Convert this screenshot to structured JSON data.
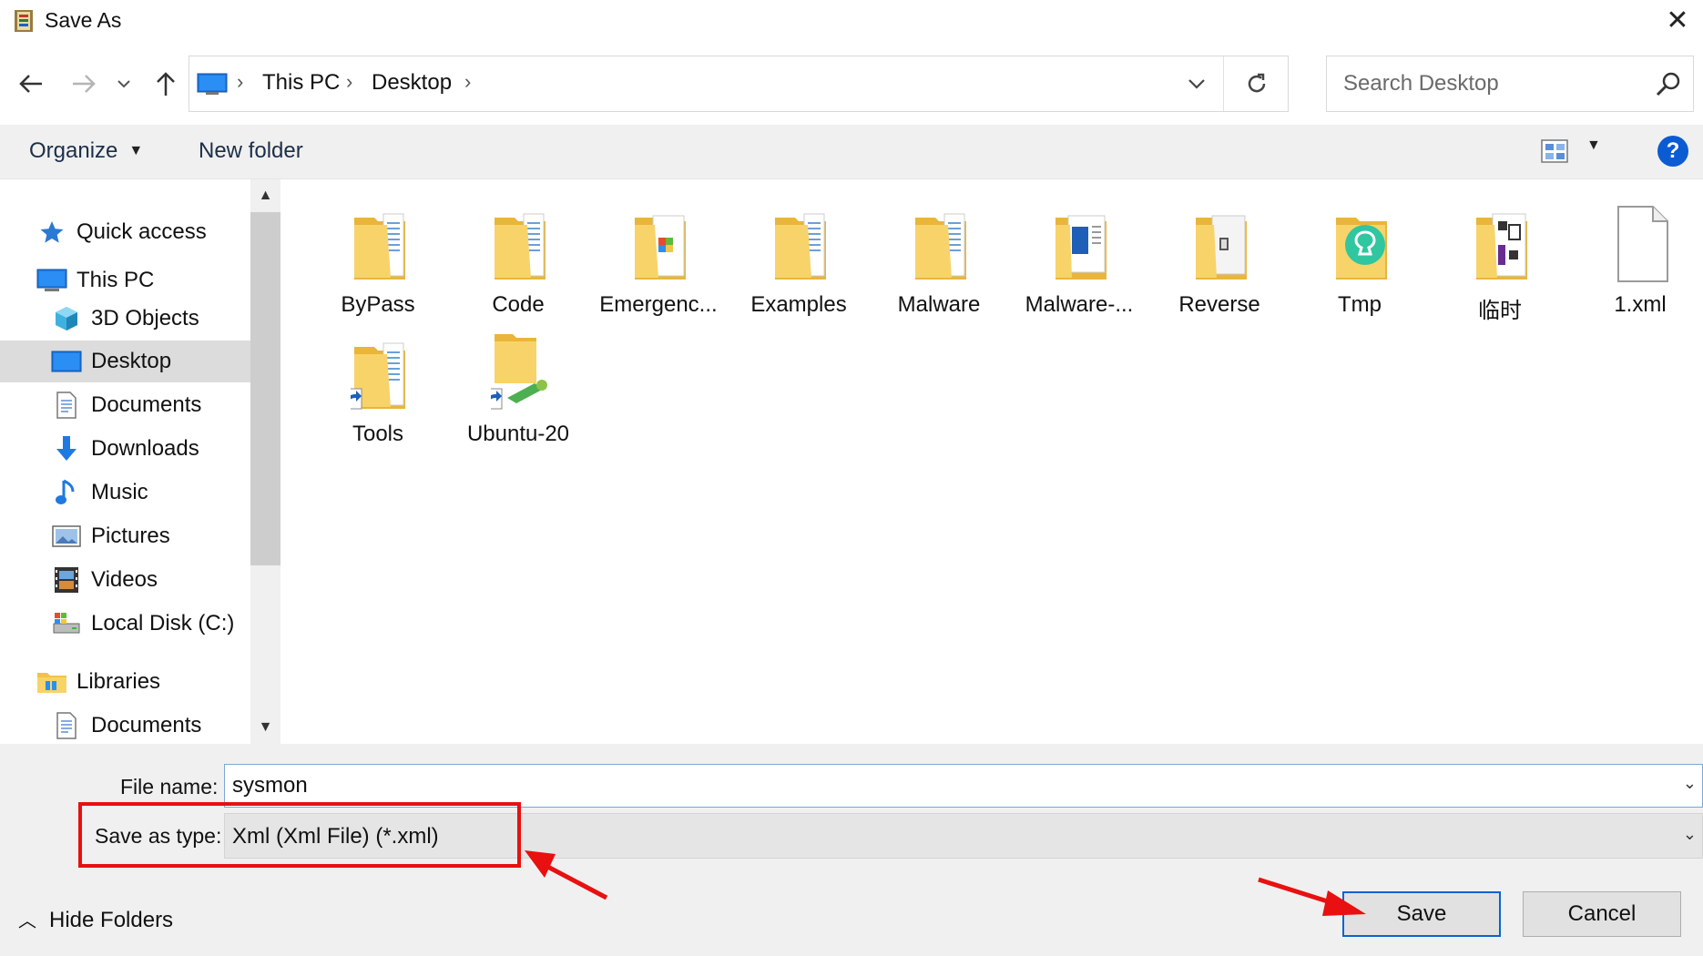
{
  "window": {
    "title": "Save As"
  },
  "nav": {
    "back_icon": "back-arrow-icon",
    "forward_icon": "forward-arrow-icon",
    "recent_icon": "chevron-down-icon",
    "up_icon": "up-arrow-icon"
  },
  "address": {
    "breadcrumbs": [
      "This PC",
      "Desktop"
    ]
  },
  "search": {
    "placeholder": "Search Desktop"
  },
  "toolbar": {
    "organize_label": "Organize",
    "new_folder_label": "New folder",
    "help_label": "?"
  },
  "sidebar": {
    "items": [
      {
        "label": "Quick access",
        "icon": "star-icon"
      },
      {
        "label": "This PC",
        "icon": "computer-icon"
      },
      {
        "label": "3D Objects",
        "icon": "cube-icon"
      },
      {
        "label": "Desktop",
        "icon": "desktop-icon",
        "selected": true
      },
      {
        "label": "Documents",
        "icon": "document-icon"
      },
      {
        "label": "Downloads",
        "icon": "download-icon"
      },
      {
        "label": "Music",
        "icon": "music-note-icon"
      },
      {
        "label": "Pictures",
        "icon": "picture-icon"
      },
      {
        "label": "Videos",
        "icon": "film-icon"
      },
      {
        "label": "Local Disk (C:)",
        "icon": "disk-icon"
      },
      {
        "label": "Libraries",
        "icon": "library-folder-icon"
      },
      {
        "label": "Documents",
        "icon": "document-icon"
      }
    ]
  },
  "files": [
    {
      "name": "ByPass",
      "type": "folder"
    },
    {
      "name": "Code",
      "type": "folder"
    },
    {
      "name": "Emergenc...",
      "type": "folder"
    },
    {
      "name": "Examples",
      "type": "folder"
    },
    {
      "name": "Malware",
      "type": "folder"
    },
    {
      "name": "Malware-...",
      "type": "folder"
    },
    {
      "name": "Reverse",
      "type": "folder"
    },
    {
      "name": "Tmp",
      "type": "folder"
    },
    {
      "name": "临时",
      "type": "folder"
    },
    {
      "name": "1.xml",
      "type": "file"
    },
    {
      "name": "Tools",
      "type": "folder-shortcut"
    },
    {
      "name": "Ubuntu-20",
      "type": "network-shortcut"
    }
  ],
  "form": {
    "file_name_label": "File name:",
    "file_name_value": "sysmon",
    "save_type_label": "Save as type:",
    "save_type_value": "Xml (Xml File) (*.xml)"
  },
  "footer": {
    "hide_folders_label": "Hide Folders",
    "save_label": "Save",
    "cancel_label": "Cancel"
  },
  "colors": {
    "annotation": "#e81010",
    "accent": "#0b63cf",
    "folder": "#f5c94c"
  }
}
